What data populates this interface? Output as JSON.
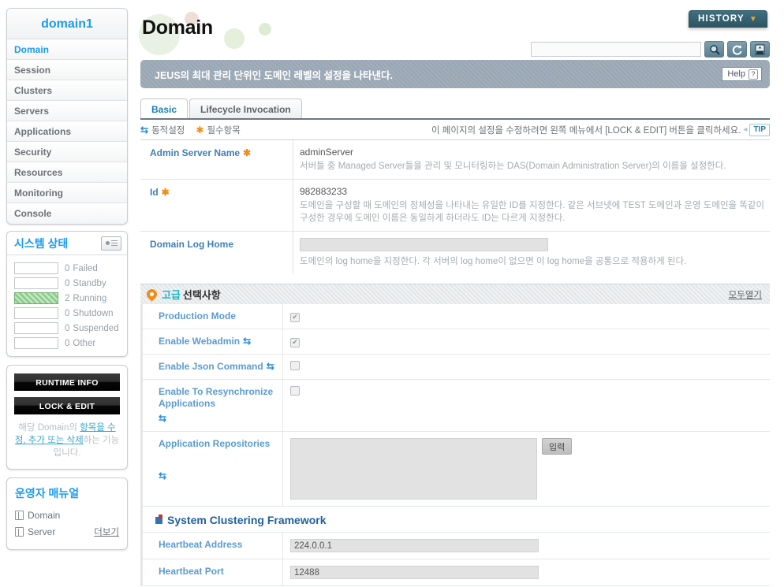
{
  "sidebar": {
    "domain_name": "domain1",
    "nav_items": [
      {
        "label": "Domain",
        "active": true
      },
      {
        "label": "Session",
        "active": false
      },
      {
        "label": "Clusters",
        "active": false
      },
      {
        "label": "Servers",
        "active": false
      },
      {
        "label": "Applications",
        "active": false
      },
      {
        "label": "Security",
        "active": false
      },
      {
        "label": "Resources",
        "active": false
      },
      {
        "label": "Monitoring",
        "active": false
      },
      {
        "label": "Console",
        "active": false
      }
    ],
    "system_status": {
      "title": "시스템 상태",
      "icon": "monitor-icon",
      "rows": [
        {
          "count": "0",
          "label": "Failed",
          "filled": false
        },
        {
          "count": "0",
          "label": "Standby",
          "filled": false
        },
        {
          "count": "2",
          "label": "Running",
          "filled": true
        },
        {
          "count": "0",
          "label": "Shutdown",
          "filled": false
        },
        {
          "count": "0",
          "label": "Suspended",
          "filled": false
        },
        {
          "count": "0",
          "label": "Other",
          "filled": false
        }
      ]
    },
    "actions": {
      "runtime_info": "RUNTIME INFO",
      "lock_edit": "LOCK & EDIT",
      "note_part1": "해당 Domain의 ",
      "note_link": "항목을 수정, 추가 또는 삭제",
      "note_part2": "하는 기능입니다."
    },
    "manual": {
      "title": "운영자 매뉴얼",
      "items": [
        {
          "label": "Domain",
          "icon": "document-icon"
        },
        {
          "label": "Server",
          "icon": "document-icon"
        }
      ],
      "more": "더보기"
    }
  },
  "header": {
    "page_title": "Domain",
    "history_button": "HISTORY",
    "history_chevron": "chevron-down-icon",
    "search_value": "",
    "search_placeholder": "",
    "icon_buttons": [
      {
        "name": "search-icon"
      },
      {
        "name": "refresh-icon"
      },
      {
        "name": "xml-export-icon"
      }
    ]
  },
  "description": {
    "text": "JEUS의 최대 관리 단위인 도메인 레벨의 설정을 나타낸다.",
    "help_label": "Help",
    "help_icon": "question-icon"
  },
  "tabs": [
    {
      "label": "Basic",
      "active": true
    },
    {
      "label": "Lifecycle Invocation",
      "active": false
    }
  ],
  "legend": {
    "dynamic": "동적설정",
    "required": "필수항목",
    "tip_text": "이 페이지의 설정을 수정하려면 왼쪽 메뉴에서 [LOCK & EDIT] 버튼을 클릭하세요.",
    "tip_badge": "TIP"
  },
  "basic_fields": [
    {
      "label": "Admin Server Name",
      "required": true,
      "dynamic": false,
      "value": "adminServer",
      "input": false,
      "description": "서버들 중 Managed Server들을 관리 및 모니터링하는 DAS(Domain Administration Server)의 이름을 설정한다."
    },
    {
      "label": "Id",
      "required": true,
      "dynamic": false,
      "value": "982883233",
      "input": false,
      "description": "도메인을 구성할 때 도메인의 정체성을 나타내는 유일한 ID를 지정한다. 같은 서브넷에 TEST 도메인과 운영 도메인을 똑같이 구성한 경우에 도메인 이름은 동일하게 하더라도 ID는 다르게 지정한다."
    },
    {
      "label": "Domain Log Home",
      "required": false,
      "dynamic": false,
      "value": "",
      "input": true,
      "description": "도메인의 log home을 지정한다. 각 서버의 log home이 없으면 이 log home을 공통으로 적용하게 된다."
    }
  ],
  "advanced": {
    "icon": "pin-icon",
    "title_accent": "고급",
    "title_rest": "선택사항",
    "open_all": "모두열기",
    "checkbox_rows": [
      {
        "label": "Production Mode",
        "dynamic": false,
        "checked": true
      },
      {
        "label": "Enable Webadmin",
        "dynamic": true,
        "checked": true
      },
      {
        "label": "Enable Json Command",
        "dynamic": true,
        "checked": false
      },
      {
        "label": "Enable To Resynchronize Applications",
        "dynamic": true,
        "checked": false
      }
    ],
    "repositories": {
      "label": "Application Repositories",
      "dynamic": true,
      "value": "",
      "button_label": "입력"
    },
    "clustering": {
      "icon": "section-icon",
      "title": "System Clustering Framework",
      "fields": [
        {
          "label": "Heartbeat Address",
          "value": "224.0.0.1"
        },
        {
          "label": "Heartbeat Port",
          "value": "12488"
        }
      ]
    }
  },
  "colors": {
    "accent_blue": "#1b9bf0",
    "label_blue": "#3f7fb5",
    "desc_bar": "#99a6b3",
    "running_green": "#8fce8f",
    "required_orange": "#f08c18",
    "history_teal": "#3f6f80"
  }
}
